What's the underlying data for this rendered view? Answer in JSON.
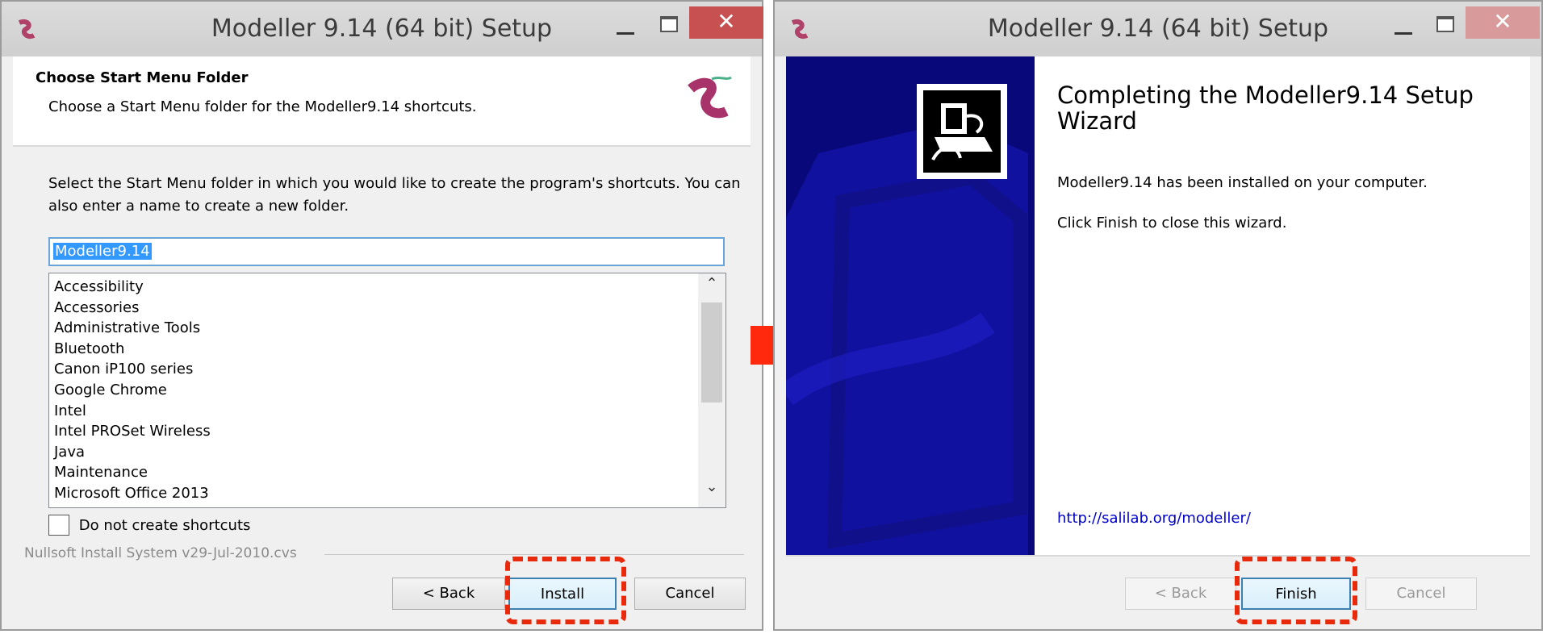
{
  "left_window": {
    "title": "Modeller 9.14 (64 bit) Setup",
    "close_glyph": "✕",
    "header_title": "Choose Start Menu Folder",
    "header_subtitle": "Choose a Start Menu folder for the Modeller9.14 shortcuts.",
    "description": "Select the Start Menu folder in which you would like to create the program's shortcuts. You can also enter a name to create a new folder.",
    "folder_input_value": "Modeller9.14",
    "folders": [
      "Accessibility",
      "Accessories",
      "Administrative Tools",
      "Bluetooth",
      "Canon iP100 series",
      "Google Chrome",
      "Intel",
      "Intel PROSet Wireless",
      "Java",
      "Maintenance",
      "Microsoft Office 2013"
    ],
    "scroll_up_glyph": "⌃",
    "scroll_down_glyph": "⌄",
    "checkbox_label": "Do not create shortcuts",
    "nsis_label": "Nullsoft Install System v29-Jul-2010.cvs",
    "buttons": {
      "back": "< Back",
      "install": "Install",
      "cancel": "Cancel"
    }
  },
  "right_window": {
    "title": "Modeller 9.14 (64 bit) Setup",
    "close_glyph": "✕",
    "heading": "Completing the Modeller9.14 Setup Wizard",
    "installed_text": "Modeller9.14 has been installed on your computer.",
    "finish_hint": "Click Finish to close this wizard.",
    "link": "http://salilab.org/modeller/",
    "buttons": {
      "back": "< Back",
      "finish": "Finish",
      "cancel": "Cancel"
    }
  },
  "colors": {
    "highlight": "#e8290b",
    "arrow": "#ff2a0e",
    "side_panel": "#08087a",
    "link": "#0000cc"
  },
  "icons": [
    "app-icon",
    "modeller-logo-icon",
    "installer-icon",
    "arrow-right-icon",
    "scroll-up-icon",
    "scroll-down-icon"
  ]
}
